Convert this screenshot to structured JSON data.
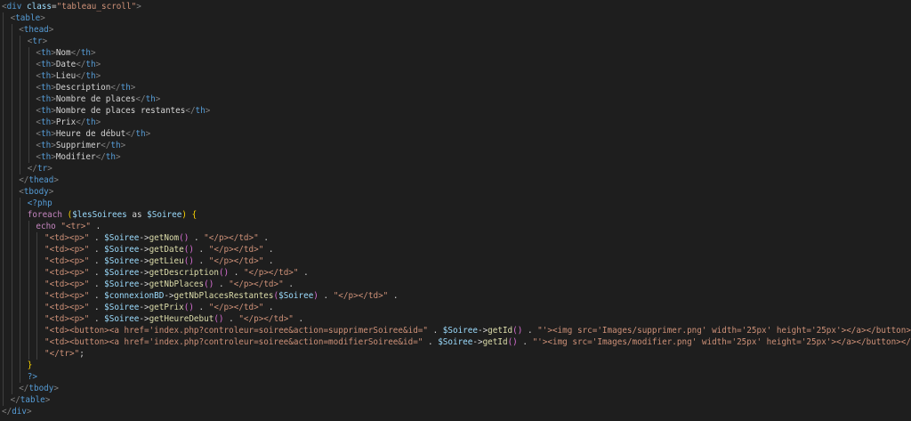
{
  "editor": {
    "background": "#1e1e1e",
    "lines": [
      {
        "indent": 0,
        "tokens": [
          [
            "punct",
            "<"
          ],
          [
            "tag",
            "div"
          ],
          [
            "text",
            " "
          ],
          [
            "attr",
            "class"
          ],
          [
            "op",
            "="
          ],
          [
            "str",
            "\"tableau_scroll\""
          ],
          [
            "punct",
            ">"
          ]
        ]
      },
      {
        "indent": 1,
        "tokens": [
          [
            "punct",
            "<"
          ],
          [
            "tag",
            "table"
          ],
          [
            "punct",
            ">"
          ]
        ]
      },
      {
        "indent": 2,
        "tokens": [
          [
            "punct",
            "<"
          ],
          [
            "tag",
            "thead"
          ],
          [
            "punct",
            ">"
          ]
        ]
      },
      {
        "indent": 3,
        "tokens": [
          [
            "punct",
            "<"
          ],
          [
            "tag",
            "tr"
          ],
          [
            "punct",
            ">"
          ]
        ]
      },
      {
        "indent": 4,
        "tokens": [
          [
            "punct",
            "<"
          ],
          [
            "tag",
            "th"
          ],
          [
            "punct",
            ">"
          ],
          [
            "text",
            "Nom"
          ],
          [
            "punct",
            "</"
          ],
          [
            "tag",
            "th"
          ],
          [
            "punct",
            ">"
          ]
        ]
      },
      {
        "indent": 4,
        "tokens": [
          [
            "punct",
            "<"
          ],
          [
            "tag",
            "th"
          ],
          [
            "punct",
            ">"
          ],
          [
            "text",
            "Date"
          ],
          [
            "punct",
            "</"
          ],
          [
            "tag",
            "th"
          ],
          [
            "punct",
            ">"
          ]
        ]
      },
      {
        "indent": 4,
        "tokens": [
          [
            "punct",
            "<"
          ],
          [
            "tag",
            "th"
          ],
          [
            "punct",
            ">"
          ],
          [
            "text",
            "Lieu"
          ],
          [
            "punct",
            "</"
          ],
          [
            "tag",
            "th"
          ],
          [
            "punct",
            ">"
          ]
        ]
      },
      {
        "indent": 4,
        "tokens": [
          [
            "punct",
            "<"
          ],
          [
            "tag",
            "th"
          ],
          [
            "punct",
            ">"
          ],
          [
            "text",
            "Description"
          ],
          [
            "punct",
            "</"
          ],
          [
            "tag",
            "th"
          ],
          [
            "punct",
            ">"
          ]
        ]
      },
      {
        "indent": 4,
        "tokens": [
          [
            "punct",
            "<"
          ],
          [
            "tag",
            "th"
          ],
          [
            "punct",
            ">"
          ],
          [
            "text",
            "Nombre de places"
          ],
          [
            "punct",
            "</"
          ],
          [
            "tag",
            "th"
          ],
          [
            "punct",
            ">"
          ]
        ]
      },
      {
        "indent": 4,
        "tokens": [
          [
            "punct",
            "<"
          ],
          [
            "tag",
            "th"
          ],
          [
            "punct",
            ">"
          ],
          [
            "text",
            "Nombre de places restantes"
          ],
          [
            "punct",
            "</"
          ],
          [
            "tag",
            "th"
          ],
          [
            "punct",
            ">"
          ]
        ]
      },
      {
        "indent": 4,
        "tokens": [
          [
            "punct",
            "<"
          ],
          [
            "tag",
            "th"
          ],
          [
            "punct",
            ">"
          ],
          [
            "text",
            "Prix"
          ],
          [
            "punct",
            "</"
          ],
          [
            "tag",
            "th"
          ],
          [
            "punct",
            ">"
          ]
        ]
      },
      {
        "indent": 4,
        "tokens": [
          [
            "punct",
            "<"
          ],
          [
            "tag",
            "th"
          ],
          [
            "punct",
            ">"
          ],
          [
            "text",
            "Heure de début"
          ],
          [
            "punct",
            "</"
          ],
          [
            "tag",
            "th"
          ],
          [
            "punct",
            ">"
          ]
        ]
      },
      {
        "indent": 4,
        "tokens": [
          [
            "punct",
            "<"
          ],
          [
            "tag",
            "th"
          ],
          [
            "punct",
            ">"
          ],
          [
            "text",
            "Supprimer"
          ],
          [
            "punct",
            "</"
          ],
          [
            "tag",
            "th"
          ],
          [
            "punct",
            ">"
          ]
        ]
      },
      {
        "indent": 4,
        "tokens": [
          [
            "punct",
            "<"
          ],
          [
            "tag",
            "th"
          ],
          [
            "punct",
            ">"
          ],
          [
            "text",
            "Modifier"
          ],
          [
            "punct",
            "</"
          ],
          [
            "tag",
            "th"
          ],
          [
            "punct",
            ">"
          ]
        ]
      },
      {
        "indent": 3,
        "tokens": [
          [
            "punct",
            "</"
          ],
          [
            "tag",
            "tr"
          ],
          [
            "punct",
            ">"
          ]
        ]
      },
      {
        "indent": 2,
        "tokens": [
          [
            "punct",
            "</"
          ],
          [
            "tag",
            "thead"
          ],
          [
            "punct",
            ">"
          ]
        ]
      },
      {
        "indent": 2,
        "tokens": [
          [
            "punct",
            "<"
          ],
          [
            "tag",
            "tbody"
          ],
          [
            "punct",
            ">"
          ]
        ]
      },
      {
        "indent": 3,
        "tokens": [
          [
            "php",
            "<?php"
          ]
        ]
      },
      {
        "indent": 3,
        "tokens": [
          [
            "kw",
            "foreach"
          ],
          [
            "text",
            " "
          ],
          [
            "paren",
            "("
          ],
          [
            "var",
            "$lesSoirees"
          ],
          [
            "text",
            " as "
          ],
          [
            "var",
            "$Soiree"
          ],
          [
            "paren",
            ")"
          ],
          [
            "text",
            " "
          ],
          [
            "paren",
            "{"
          ]
        ]
      },
      {
        "indent": 4,
        "tokens": [
          [
            "kw",
            "echo"
          ],
          [
            "text",
            " "
          ],
          [
            "str",
            "\"<tr>\""
          ],
          [
            "text",
            " ."
          ]
        ]
      },
      {
        "indent": 5,
        "tokens": [
          [
            "str",
            "\"<td><p>\""
          ],
          [
            "text",
            " . "
          ],
          [
            "var",
            "$Soiree"
          ],
          [
            "text",
            "->"
          ],
          [
            "fn",
            "getNom"
          ],
          [
            "brace",
            "()"
          ],
          [
            "text",
            " . "
          ],
          [
            "str",
            "\"</p></td>\""
          ],
          [
            "text",
            " ."
          ]
        ]
      },
      {
        "indent": 5,
        "tokens": [
          [
            "str",
            "\"<td><p>\""
          ],
          [
            "text",
            " . "
          ],
          [
            "var",
            "$Soiree"
          ],
          [
            "text",
            "->"
          ],
          [
            "fn",
            "getDate"
          ],
          [
            "brace",
            "()"
          ],
          [
            "text",
            " . "
          ],
          [
            "str",
            "\"</p></td>\""
          ],
          [
            "text",
            " ."
          ]
        ]
      },
      {
        "indent": 5,
        "tokens": [
          [
            "str",
            "\"<td><p>\""
          ],
          [
            "text",
            " . "
          ],
          [
            "var",
            "$Soiree"
          ],
          [
            "text",
            "->"
          ],
          [
            "fn",
            "getLieu"
          ],
          [
            "brace",
            "()"
          ],
          [
            "text",
            " . "
          ],
          [
            "str",
            "\"</p></td>\""
          ],
          [
            "text",
            " ."
          ]
        ]
      },
      {
        "indent": 5,
        "tokens": [
          [
            "str",
            "\"<td><p>\""
          ],
          [
            "text",
            " . "
          ],
          [
            "var",
            "$Soiree"
          ],
          [
            "text",
            "->"
          ],
          [
            "fn",
            "getDescription"
          ],
          [
            "brace",
            "()"
          ],
          [
            "text",
            " . "
          ],
          [
            "str",
            "\"</p></td>\""
          ],
          [
            "text",
            " ."
          ]
        ]
      },
      {
        "indent": 5,
        "tokens": [
          [
            "str",
            "\"<td><p>\""
          ],
          [
            "text",
            " . "
          ],
          [
            "var",
            "$Soiree"
          ],
          [
            "text",
            "->"
          ],
          [
            "fn",
            "getNbPlaces"
          ],
          [
            "brace",
            "()"
          ],
          [
            "text",
            " . "
          ],
          [
            "str",
            "\"</p></td>\""
          ],
          [
            "text",
            " ."
          ]
        ]
      },
      {
        "indent": 5,
        "tokens": [
          [
            "str",
            "\"<td><p>\""
          ],
          [
            "text",
            " . "
          ],
          [
            "var",
            "$connexionBD"
          ],
          [
            "text",
            "->"
          ],
          [
            "fn",
            "getNbPlacesRestantes"
          ],
          [
            "brace",
            "("
          ],
          [
            "var",
            "$Soiree"
          ],
          [
            "brace",
            ")"
          ],
          [
            "text",
            " . "
          ],
          [
            "str",
            "\"</p></td>\""
          ],
          [
            "text",
            " ."
          ]
        ]
      },
      {
        "indent": 5,
        "tokens": [
          [
            "str",
            "\"<td><p>\""
          ],
          [
            "text",
            " . "
          ],
          [
            "var",
            "$Soiree"
          ],
          [
            "text",
            "->"
          ],
          [
            "fn",
            "getPrix"
          ],
          [
            "brace",
            "()"
          ],
          [
            "text",
            " . "
          ],
          [
            "str",
            "\"</p></td>\""
          ],
          [
            "text",
            " ."
          ]
        ]
      },
      {
        "indent": 5,
        "tokens": [
          [
            "str",
            "\"<td><p>\""
          ],
          [
            "text",
            " . "
          ],
          [
            "var",
            "$Soiree"
          ],
          [
            "text",
            "->"
          ],
          [
            "fn",
            "getHeureDebut"
          ],
          [
            "brace",
            "()"
          ],
          [
            "text",
            " . "
          ],
          [
            "str",
            "\"</p></td>\""
          ],
          [
            "text",
            " ."
          ]
        ]
      },
      {
        "indent": 5,
        "tokens": [
          [
            "str",
            "\"<td><button><a href='index.php?controleur=soiree&action=supprimerSoiree&id=\""
          ],
          [
            "text",
            " . "
          ],
          [
            "var",
            "$Soiree"
          ],
          [
            "text",
            "->"
          ],
          [
            "fn",
            "getId"
          ],
          [
            "brace",
            "()"
          ],
          [
            "text",
            " . "
          ],
          [
            "str",
            "\"'><img src='Images/supprimer.png' width='25px' height='25px'></a></button></td>\""
          ],
          [
            "text",
            " ."
          ]
        ]
      },
      {
        "indent": 5,
        "tokens": [
          [
            "str",
            "\"<td><button><a href='index.php?controleur=soiree&action=modifierSoiree&id=\""
          ],
          [
            "text",
            " . "
          ],
          [
            "var",
            "$Soiree"
          ],
          [
            "text",
            "->"
          ],
          [
            "fn",
            "getId"
          ],
          [
            "brace",
            "()"
          ],
          [
            "text",
            " . "
          ],
          [
            "str",
            "\"'><img src='Images/modifier.png' width='25px' height='25px'></a></button></td>\""
          ],
          [
            "text",
            " ."
          ]
        ]
      },
      {
        "indent": 5,
        "tokens": [
          [
            "str",
            "\"</tr>\""
          ],
          [
            "text",
            ";"
          ]
        ]
      },
      {
        "indent": 3,
        "tokens": [
          [
            "paren",
            "}"
          ]
        ]
      },
      {
        "indent": 3,
        "tokens": [
          [
            "php",
            "?>"
          ]
        ]
      },
      {
        "indent": 2,
        "tokens": [
          [
            "punct",
            "</"
          ],
          [
            "tag",
            "tbody"
          ],
          [
            "punct",
            ">"
          ]
        ]
      },
      {
        "indent": 1,
        "tokens": [
          [
            "punct",
            "</"
          ],
          [
            "tag",
            "table"
          ],
          [
            "punct",
            ">"
          ]
        ]
      },
      {
        "indent": 0,
        "tokens": [
          [
            "punct",
            "</"
          ],
          [
            "tag",
            "div"
          ],
          [
            "punct",
            ">"
          ]
        ]
      }
    ]
  }
}
